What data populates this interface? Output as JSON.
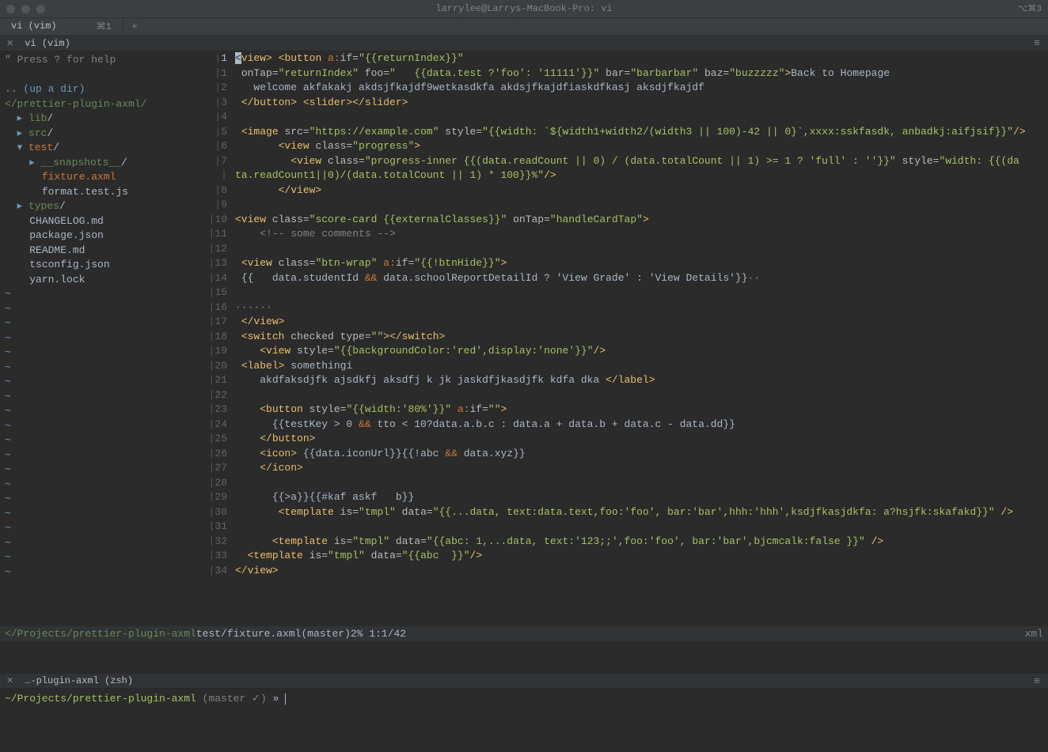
{
  "title": "larrylee@Larrys-MacBook-Pro: vi",
  "titlebar_right": "⌥⌘3",
  "tab": {
    "label": "vi (vim)",
    "shortcut": "⌘1"
  },
  "subtab": "vi (vim)",
  "file_tree": {
    "help_line": "\" Press ? for help",
    "up_dir": ".. (up a dir)",
    "root": "</prettier-plugin-axml/",
    "items": [
      {
        "indent": 1,
        "arrow": "▸",
        "name": "lib",
        "type": "dir"
      },
      {
        "indent": 1,
        "arrow": "▸",
        "name": "src",
        "type": "dir"
      },
      {
        "indent": 1,
        "arrow": "▾",
        "name": "test",
        "type": "dir-sel"
      },
      {
        "indent": 2,
        "arrow": "▸",
        "name": "__snapshots__",
        "type": "dir"
      },
      {
        "indent": 2,
        "arrow": "",
        "name": "fixture.axml",
        "type": "file-sel"
      },
      {
        "indent": 2,
        "arrow": "",
        "name": "format.test.js",
        "type": "file"
      },
      {
        "indent": 1,
        "arrow": "▸",
        "name": "types",
        "type": "dir"
      },
      {
        "indent": 1,
        "arrow": "",
        "name": "CHANGELOG.md",
        "type": "file"
      },
      {
        "indent": 1,
        "arrow": "",
        "name": "package.json",
        "type": "file"
      },
      {
        "indent": 1,
        "arrow": "",
        "name": "README.md",
        "type": "file"
      },
      {
        "indent": 1,
        "arrow": "",
        "name": "tsconfig.json",
        "type": "file"
      },
      {
        "indent": 1,
        "arrow": "",
        "name": "yarn.lock",
        "type": "file"
      }
    ],
    "tilde_count": 20
  },
  "code_lines": [
    {
      "n": 1,
      "cur": true,
      "html": "<span class='cursor'>&lt;</span><span class='tag'>view&gt;</span> <span class='tag'>&lt;button</span> <span class='ns'>a:</span><span class='attr'>if=</span><span class='str'>\"{{returnIndex}}\"</span>"
    },
    {
      "n": 1,
      "html": " <span class='attr'>onTap=</span><span class='str'>\"returnIndex\"</span> <span class='attr'>foo=</span><span class='str'>\"   {{data.test ?'foo': '11111'}}\"</span> <span class='attr'>bar=</span><span class='str'>\"barbarbar\"</span> <span class='attr'>baz=</span><span class='str'>\"buzzzzz\"</span><span class='tag'>&gt;</span><span class='txt'>Back to Homepage</span>"
    },
    {
      "n": 2,
      "html": "   <span class='txt'>welcome akfakakj akdsjfkajdf9wetkasdkfa akdsjfkajdfiaskdfkasj aksdjfkajdf</span>"
    },
    {
      "n": 3,
      "html": " <span class='tag'>&lt;/button&gt;</span> <span class='tag'>&lt;slider&gt;&lt;/slider&gt;</span>"
    },
    {
      "n": 4,
      "html": ""
    },
    {
      "n": 5,
      "html": " <span class='tag'>&lt;image</span> <span class='attr'>src=</span><span class='str'>\"https://example.com\"</span> <span class='attr'>style=</span><span class='str'>\"{{width: `${width1+width2/(width3 || 100)-42 || 0}`,xxxx:sskfasdk, anbadkj:aifjsif}}\"</span><span class='tag'>/&gt;</span>"
    },
    {
      "n": 6,
      "html": "       <span class='tag'>&lt;view</span> <span class='attr'>class=</span><span class='str'>\"progress\"</span><span class='tag'>&gt;</span>"
    },
    {
      "n": 7,
      "html": "         <span class='tag'>&lt;view</span> <span class='attr'>class=</span><span class='str'>\"progress-inner {{(data.readCount || 0) / (data.totalCount || 1) &gt;= 1 ? 'full' : ''}}\"</span> <span class='attr'>style=</span><span class='str'>\"width: {{(da</span>"
    },
    {
      "n": "",
      "html": "<span class='str'>ta.readCount1||0)/(data.totalCount || 1) * 100}}%\"</span><span class='tag'>/&gt;</span>"
    },
    {
      "n": 8,
      "html": "       <span class='tag'>&lt;/view&gt;</span>"
    },
    {
      "n": 9,
      "html": ""
    },
    {
      "n": 10,
      "html": "<span class='tag'>&lt;view</span> <span class='attr'>class=</span><span class='str'>\"score-card {{externalClasses}}\"</span> <span class='attr'>onTap=</span><span class='str'>\"handleCardTap\"</span><span class='tag'>&gt;</span>"
    },
    {
      "n": 11,
      "html": "    <span class='cmt'>&lt;!-- some comments --&gt;</span>"
    },
    {
      "n": 12,
      "html": ""
    },
    {
      "n": 13,
      "html": " <span class='tag'>&lt;view</span> <span class='attr'>class=</span><span class='str'>\"btn-wrap\"</span> <span class='ns'>a:</span><span class='attr'>if=</span><span class='str'>\"{{!btnHide}}\"</span><span class='tag'>&gt;</span>"
    },
    {
      "n": 14,
      "html": " <span class='txt'>{{   data.studentId </span><span class='op'>&amp;&amp;</span><span class='txt'> data.schoolReportDetailId ? 'View Grade' : 'View Details'}}</span><span class='cmt'>··</span>"
    },
    {
      "n": 15,
      "html": ""
    },
    {
      "n": 16,
      "html": "<span class='cmt'>······</span>"
    },
    {
      "n": 17,
      "html": " <span class='tag'>&lt;/view&gt;</span>"
    },
    {
      "n": 18,
      "html": " <span class='tag'>&lt;switch</span> <span class='attr'>checked</span> <span class='attr'>type=</span><span class='str'>\"\"</span><span class='tag'>&gt;&lt;/switch&gt;</span>"
    },
    {
      "n": 19,
      "html": "    <span class='tag'>&lt;view</span> <span class='attr'>style=</span><span class='str'>\"{{backgroundColor:'red',display:'none'}}\"</span><span class='tag'>/&gt;</span>"
    },
    {
      "n": 20,
      "html": " <span class='tag'>&lt;label&gt;</span> <span class='txt'>somethingi</span>"
    },
    {
      "n": 21,
      "html": "    <span class='txt'>akdfaksdjfk ajsdkfj aksdfj k jk jaskdfjkasdjfk kdfa dka </span><span class='tag'>&lt;/label&gt;</span>"
    },
    {
      "n": 22,
      "html": ""
    },
    {
      "n": 23,
      "html": "    <span class='tag'>&lt;button</span> <span class='attr'>style=</span><span class='str'>\"{{width:'80%'}}\"</span> <span class='ns'>a:</span><span class='attr'>if=</span><span class='str'>\"\"</span><span class='tag'>&gt;</span>"
    },
    {
      "n": 24,
      "html": "      <span class='txt'>{{testKey &gt; 0 </span><span class='op'>&amp;&amp;</span><span class='txt'> tto &lt; 10?data.a.b.c : data.a + data.b + data.c - data.dd}}</span>"
    },
    {
      "n": 25,
      "html": "    <span class='tag'>&lt;/button&gt;</span>"
    },
    {
      "n": 26,
      "html": "    <span class='tag'>&lt;icon&gt;</span> <span class='txt'>{{data.iconUrl}}{{!abc </span><span class='op'>&amp;&amp;</span><span class='txt'> data.xyz}}</span>"
    },
    {
      "n": 27,
      "html": "    <span class='tag'>&lt;/icon&gt;</span>"
    },
    {
      "n": 28,
      "html": ""
    },
    {
      "n": 29,
      "html": "      <span class='txt'>{{&gt;a}}{{#kaf askf   b}}</span>"
    },
    {
      "n": 30,
      "html": "       <span class='tag'>&lt;template</span> <span class='attr'>is=</span><span class='str'>\"tmpl\"</span> <span class='attr'>data=</span><span class='str'>\"{{...data, text:data.text,foo:'foo', bar:'bar',hhh:'hhh',ksdjfkasjdkfa: a?hsjfk:skafakd}}\"</span> <span class='tag'>/&gt;</span>"
    },
    {
      "n": 31,
      "html": ""
    },
    {
      "n": 32,
      "html": "      <span class='tag'>&lt;template</span> <span class='attr'>is=</span><span class='str'>\"tmpl\"</span> <span class='attr'>data=</span><span class='str'>\"{{abc: 1,...data, text:'123;;',foo:'foo', bar:'bar',bjcmcalk:false }}\"</span> <span class='tag'>/&gt;</span>"
    },
    {
      "n": 33,
      "html": "  <span class='tag'>&lt;template</span> <span class='attr'>is=</span><span class='str'>\"tmpl\"</span> <span class='attr'>data=</span><span class='str'>\"{{abc  }}\"</span><span class='tag'>/&gt;</span>"
    },
    {
      "n": 34,
      "html": "<span class='tag'>&lt;/view&gt;</span>"
    }
  ],
  "status": {
    "path": "</Projects/prettier-plugin-axml",
    "file": " test/fixture.axml",
    "branch": " (master)",
    "pos": " 2% 1:1/42",
    "filetype": "xml"
  },
  "term_tab": "…-plugin-axml (zsh)",
  "term_line": {
    "path": "~/Projects/prettier-plugin-axml",
    "branch": " (master ✓) ",
    "arrow": "» "
  }
}
